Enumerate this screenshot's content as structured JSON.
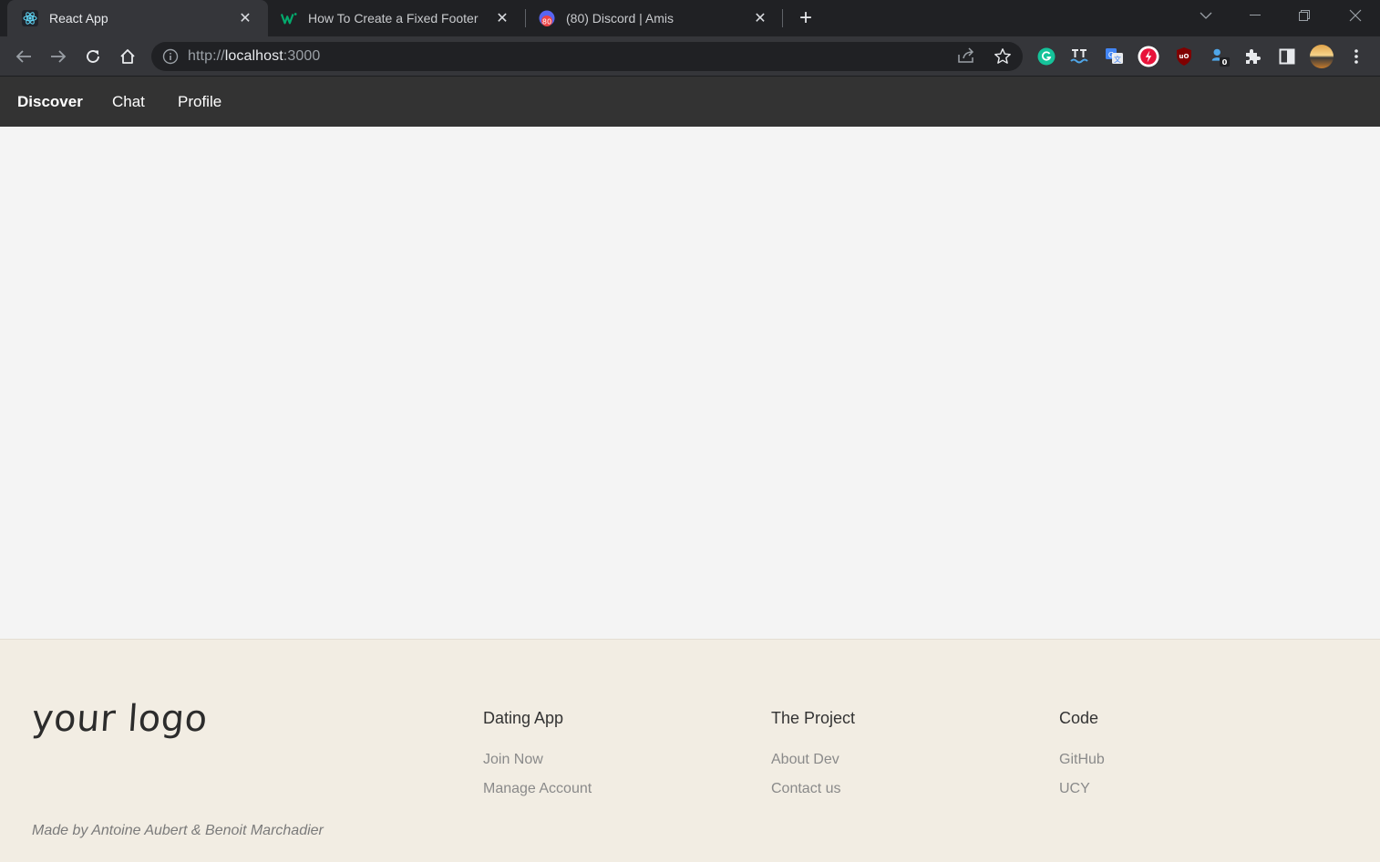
{
  "browser": {
    "tabs": [
      {
        "title": "React App",
        "favicon": "react-icon",
        "active": true
      },
      {
        "title": "How To Create a Fixed Footer",
        "favicon": "w3schools-icon",
        "active": false
      },
      {
        "title": "(80) Discord | Amis",
        "favicon": "discord-icon",
        "badge": "80",
        "active": false
      }
    ],
    "url_scheme": "http://",
    "url_host": "localhost",
    "url_port": ":3000",
    "extension_badge": "0"
  },
  "nav": {
    "items": [
      {
        "label": "Discover",
        "active": true
      },
      {
        "label": "Chat",
        "active": false
      },
      {
        "label": "Profile",
        "active": false
      }
    ]
  },
  "footer": {
    "logo_text": "your logo",
    "credit": "Made by Antoine Aubert & Benoit Marchadier",
    "columns": [
      {
        "heading": "Dating App",
        "links": [
          "Join Now",
          "Manage Account"
        ]
      },
      {
        "heading": "The Project",
        "links": [
          "About Dev",
          "Contact us"
        ]
      },
      {
        "heading": "Code",
        "links": [
          "GitHub",
          "UCY"
        ]
      }
    ]
  },
  "colors": {
    "nav_bg": "#333333",
    "content_bg": "#f4f4f4",
    "footer_bg": "#f2ede3"
  }
}
